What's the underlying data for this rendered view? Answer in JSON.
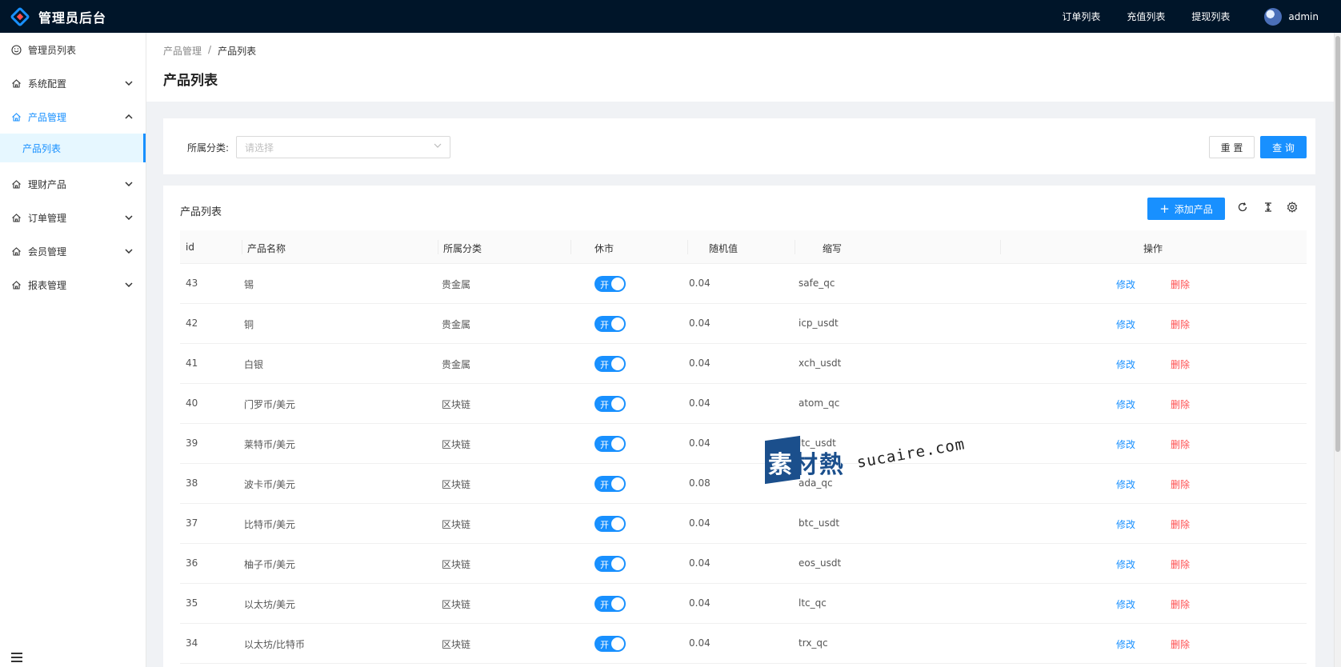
{
  "header": {
    "app_title": "管理员后台",
    "nav": [
      "订单列表",
      "充值列表",
      "提现列表"
    ],
    "user": "admin"
  },
  "sidebar": {
    "items": [
      {
        "label": "管理员列表",
        "icon": "smile-icon",
        "has_children": false
      },
      {
        "label": "系统配置",
        "icon": "home-icon",
        "has_children": true,
        "chevron": "chevron-down"
      },
      {
        "label": "产品管理",
        "icon": "home-icon",
        "has_children": true,
        "chevron": "chevron-up",
        "open": true
      },
      {
        "label": "理财产品",
        "icon": "home-icon",
        "has_children": true,
        "chevron": "chevron-down"
      },
      {
        "label": "订单管理",
        "icon": "home-icon",
        "has_children": true,
        "chevron": "chevron-down"
      },
      {
        "label": "会员管理",
        "icon": "home-icon",
        "has_children": true,
        "chevron": "chevron-down"
      },
      {
        "label": "报表管理",
        "icon": "home-icon",
        "has_children": true,
        "chevron": "chevron-down"
      }
    ],
    "active_sub": "产品列表"
  },
  "breadcrumb": [
    "产品管理",
    "/",
    "产品列表"
  ],
  "page_title": "产品列表",
  "search": {
    "category_label": "所属分类:",
    "category_placeholder": "请选择",
    "reset_label": "重 置",
    "query_label": "查 询"
  },
  "table": {
    "title": "产品列表",
    "add_label": "添加产品",
    "columns": [
      "id",
      "产品名称",
      "所属分类",
      "休市",
      "随机值",
      "缩写",
      "操作"
    ],
    "switch_on_text": "开",
    "edit_label": "修改",
    "delete_label": "删除",
    "rows": [
      {
        "id": "43",
        "name": "锡",
        "category": "贵金属",
        "random": "0.04",
        "abbr": "safe_qc"
      },
      {
        "id": "42",
        "name": "铜",
        "category": "贵金属",
        "random": "0.04",
        "abbr": "icp_usdt"
      },
      {
        "id": "41",
        "name": "白银",
        "category": "贵金属",
        "random": "0.04",
        "abbr": "xch_usdt"
      },
      {
        "id": "40",
        "name": "门罗币/美元",
        "category": "区块链",
        "random": "0.04",
        "abbr": "atom_qc"
      },
      {
        "id": "39",
        "name": "莱特币/美元",
        "category": "区块链",
        "random": "0.04",
        "abbr": "ltc_usdt"
      },
      {
        "id": "38",
        "name": "波卡币/美元",
        "category": "区块链",
        "random": "0.08",
        "abbr": "ada_qc"
      },
      {
        "id": "37",
        "name": "比特币/美元",
        "category": "区块链",
        "random": "0.04",
        "abbr": "btc_usdt"
      },
      {
        "id": "36",
        "name": "柚子币/美元",
        "category": "区块链",
        "random": "0.04",
        "abbr": "eos_usdt"
      },
      {
        "id": "35",
        "name": "以太坊/美元",
        "category": "区块链",
        "random": "0.04",
        "abbr": "ltc_qc"
      },
      {
        "id": "34",
        "name": "以太坊/比特币",
        "category": "区块链",
        "random": "0.04",
        "abbr": "trx_qc"
      }
    ]
  },
  "watermark": {
    "cn_first": "素",
    "cn_rest": "材熱",
    "en": "sucaire.com"
  },
  "colors": {
    "primary": "#1890ff",
    "danger": "#ff4d4f",
    "header_bg": "#001529"
  }
}
